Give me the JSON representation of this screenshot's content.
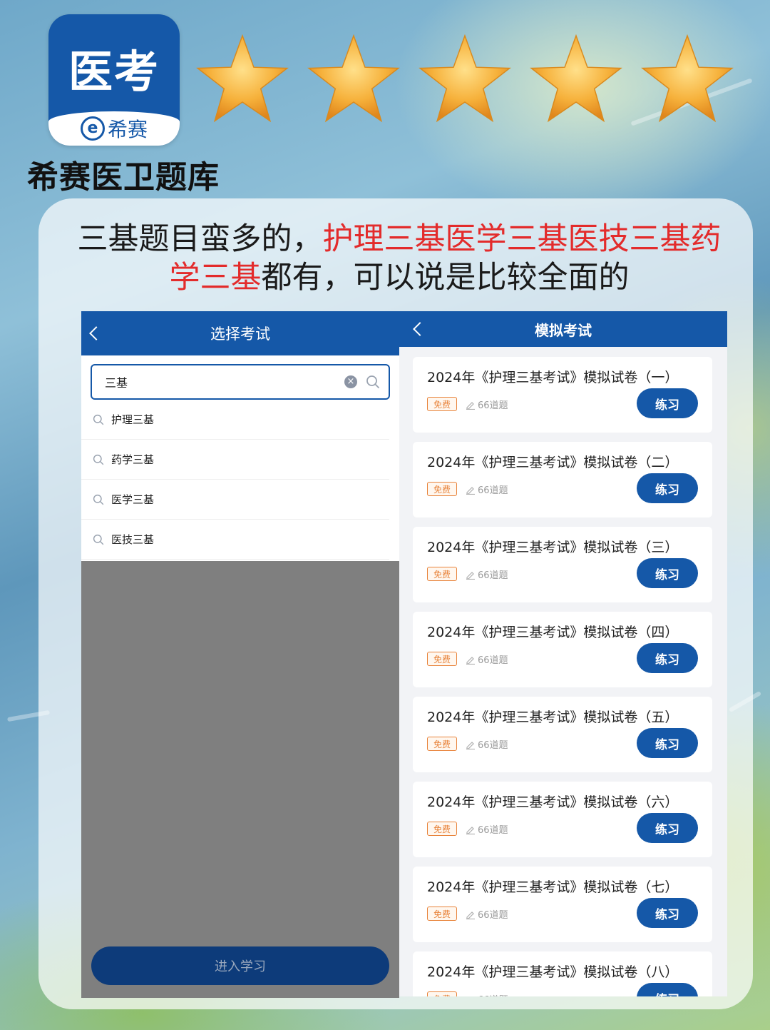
{
  "brand": {
    "logo_title": "医考",
    "logo_e": "e",
    "logo_sub": "希赛",
    "app_name": "希赛医卫题库",
    "rating_stars": 5
  },
  "headline": {
    "part1": "三基题目蛮多的，",
    "part2_red": "护理三基医学三基医技三基药学三基",
    "part3": "都有，可以说是比较全面的"
  },
  "select_exam": {
    "nav_title": "选择考试",
    "search_value": "三基",
    "suggestions": [
      "护理三基",
      "药学三基",
      "医学三基",
      "医技三基"
    ],
    "enter_button": "进入学习"
  },
  "mock_exam": {
    "nav_title": "模拟考试",
    "free_tag": "免费",
    "question_count": "66道题",
    "practice_button": "练习",
    "items": [
      "2024年《护理三基考试》模拟试卷（一）",
      "2024年《护理三基考试》模拟试卷（二）",
      "2024年《护理三基考试》模拟试卷（三）",
      "2024年《护理三基考试》模拟试卷（四）",
      "2024年《护理三基考试》模拟试卷（五）",
      "2024年《护理三基考试》模拟试卷（六）",
      "2024年《护理三基考试》模拟试卷（七）",
      "2024年《护理三基考试》模拟试卷（八）"
    ]
  },
  "colors": {
    "primary_blue": "#1558a8",
    "accent_red": "#e32b2b",
    "free_orange": "#e8833a",
    "star_gold": "#f6b13b"
  }
}
